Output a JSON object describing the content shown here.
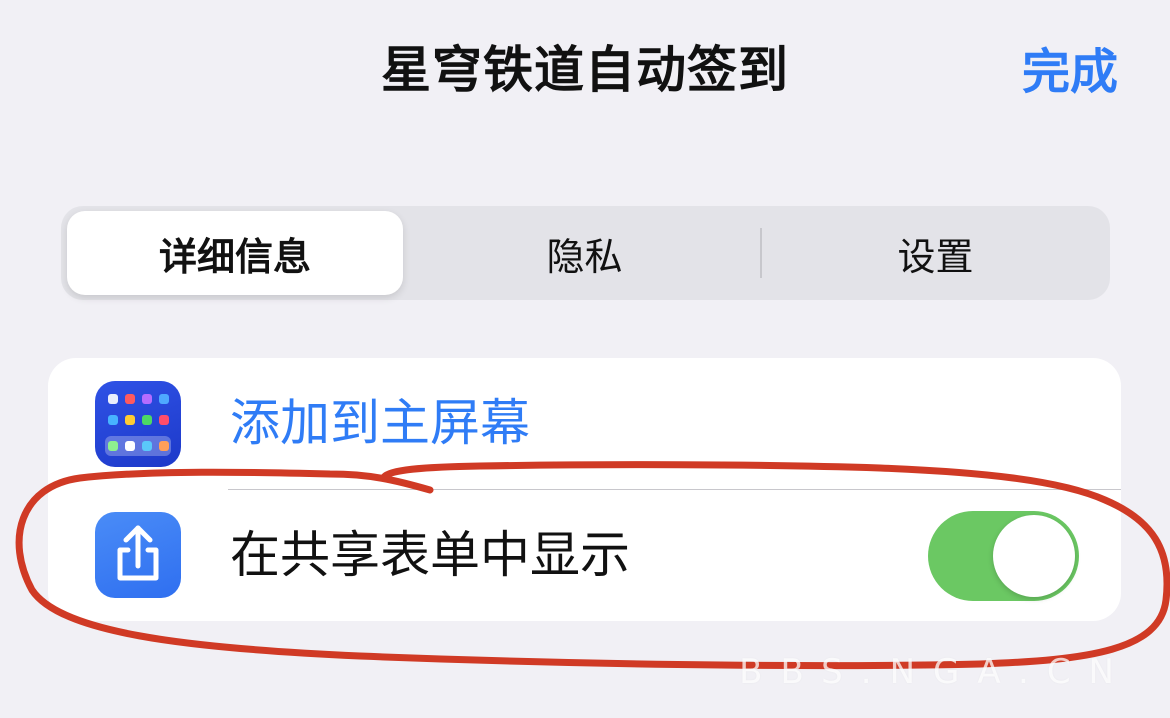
{
  "nav": {
    "title": "星穹铁道自动签到",
    "done_label": "完成"
  },
  "segments": [
    {
      "label": "详细信息",
      "selected": true
    },
    {
      "label": "隐私",
      "selected": false
    },
    {
      "label": "设置",
      "selected": false
    }
  ],
  "rows": {
    "add_to_home": {
      "label": "添加到主屏幕",
      "icon": "home-screen-icon"
    },
    "show_in_share_sheet": {
      "label": "在共享表单中显示",
      "icon": "share-icon",
      "toggle_on": true
    }
  },
  "watermark": "BBS.NGA.CN",
  "colors": {
    "accent_blue": "#2f7cf6",
    "toggle_green": "#6bc863",
    "annotation_red": "#d03a25",
    "background": "#f1f0f5"
  }
}
